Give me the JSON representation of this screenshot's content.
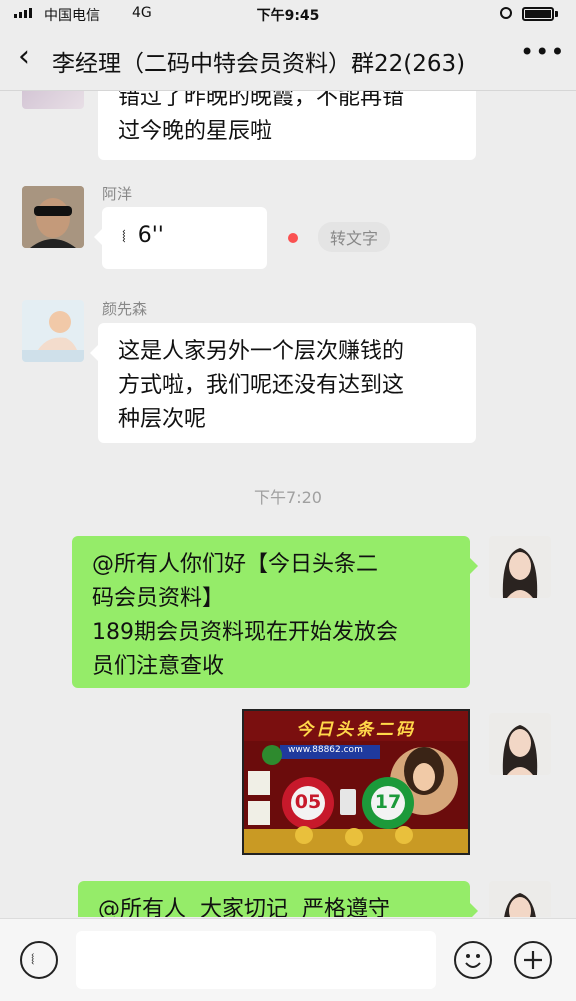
{
  "status_bar": {
    "carrier": "中国电信",
    "network": "4G",
    "time": "下午9:45"
  },
  "nav": {
    "title": "李经理（二码中特会员资料）群22(263)"
  },
  "messages": {
    "m1": {
      "text_line1": "错过了昨晚的晚霞，不能再错",
      "text_line2": "过今晚的星辰啦"
    },
    "m2": {
      "sender": "阿洋",
      "duration": "6''",
      "transcribe_label": "转文字"
    },
    "m3": {
      "sender": "颜先森",
      "line1": "这是人家另外一个层次赚钱的",
      "line2": "方式啦，我们呢还没有达到这",
      "line3": "种层次呢"
    },
    "timestamp": "下午7:20",
    "m4": {
      "line1": "@所有人你们好【今日头条二",
      "line2": "码会员资料】",
      "line3": "189期会员资料现在开始发放会",
      "line4": "员们注意查收"
    },
    "m5": {
      "banner_title": "今日头条二码",
      "url": "www.88862.com",
      "num1": "05",
      "num2": "17"
    },
    "m6": {
      "partial_text": "@所有人  大家切记  严格遵守"
    }
  },
  "colors": {
    "accent_green": "#95ec69",
    "unread_dot": "#fa5151"
  }
}
